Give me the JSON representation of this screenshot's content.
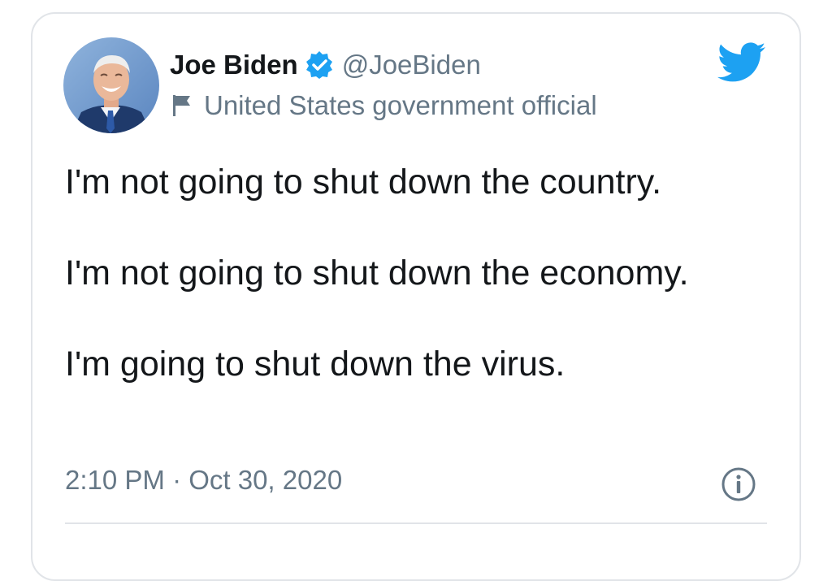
{
  "tweet": {
    "display_name": "Joe Biden",
    "handle": "@JoeBiden",
    "account_label": "United States government official",
    "paragraphs": [
      "I'm not going to shut down the country.",
      "I'm not going to shut down the economy.",
      "I'm going to shut down the virus."
    ],
    "timestamp": "2:10 PM · Oct 30, 2020"
  },
  "icons": {
    "verified": "verified-badge-icon",
    "flag": "flag-icon",
    "brand": "twitter-bird-icon",
    "info": "info-icon"
  },
  "colors": {
    "brand": "#1da1f2",
    "text": "#14171a",
    "secondary": "#657786",
    "border": "#e1e4e8"
  }
}
